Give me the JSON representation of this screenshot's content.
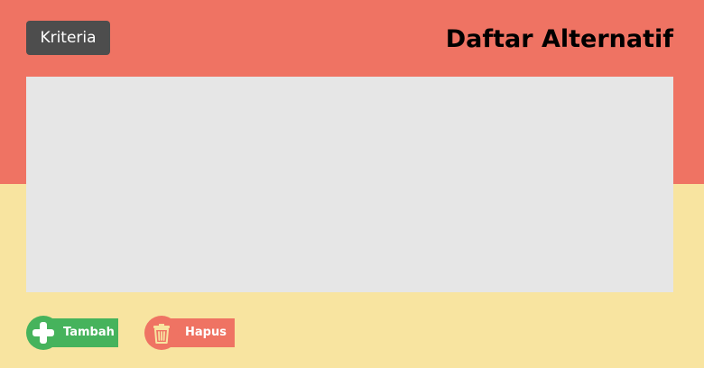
{
  "header": {
    "kriteria_label": "Kriteria",
    "title": "Daftar Alternatif"
  },
  "actions": {
    "add_label": "Tambah",
    "delete_label": "Hapus"
  },
  "icons": {
    "add": "plus-icon",
    "delete": "trash-icon"
  },
  "colors": {
    "header_background": "#ef7363",
    "page_background": "#f8e4a0",
    "kriteria_button": "#4d4d4d",
    "panel": "#e6e6e6",
    "add": "#46b35c",
    "delete": "#ef7363",
    "delete_icon": "#f8e4a0"
  }
}
